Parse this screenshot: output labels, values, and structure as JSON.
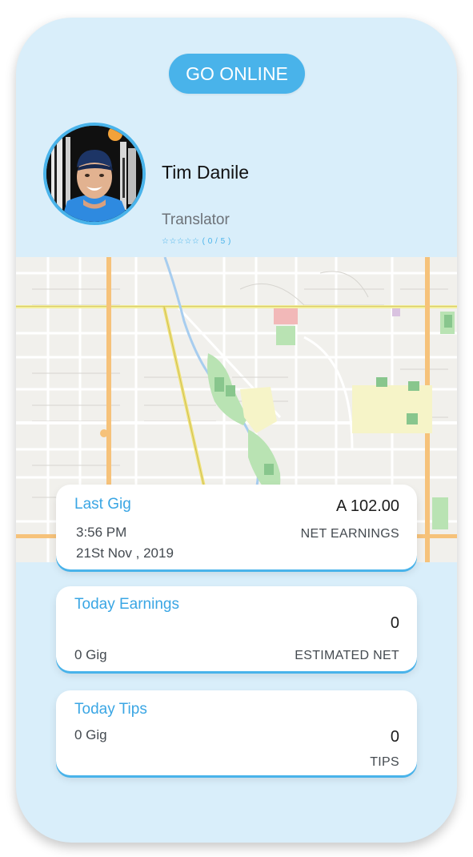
{
  "header": {
    "go_online_label": "GO ONLINE"
  },
  "profile": {
    "name": "Tim Danile",
    "role": "Translator",
    "rating_text": "☆☆☆☆☆ ( 0 / 5 )"
  },
  "map": {
    "label": "map-view"
  },
  "last_gig": {
    "title": "Last Gig",
    "amount": "A 102.00",
    "time": "3:56 PM",
    "date": "21St Nov , 2019",
    "caption": "NET EARNINGS"
  },
  "today_earnings": {
    "title": "Today Earnings",
    "amount": "0",
    "gigs": "0 Gig",
    "caption": "ESTIMATED NET"
  },
  "today_tips": {
    "title": "Today Tips",
    "gigs": "0 Gig",
    "amount": "0",
    "caption": "TIPS"
  },
  "colors": {
    "accent": "#49b3ea",
    "background": "#d9eefa",
    "card": "#ffffff"
  }
}
